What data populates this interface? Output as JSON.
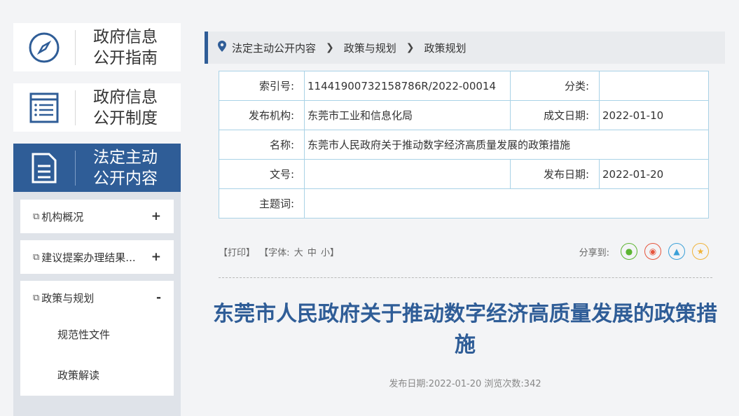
{
  "sidebar": {
    "cards": [
      {
        "label": "政府信息\n公开指南",
        "icon": "compass-icon"
      },
      {
        "label": "政府信息\n公开制度",
        "icon": "document-list-icon"
      },
      {
        "label": "法定主动\n公开内容",
        "icon": "document-icon"
      }
    ],
    "items": [
      {
        "label": "机构概况",
        "toggle": "+"
      },
      {
        "label": "建议提案办理结果...",
        "toggle": "+"
      },
      {
        "label": "政策与规划",
        "toggle": "-"
      }
    ],
    "children": [
      "规范性文件",
      "政策解读"
    ]
  },
  "breadcrumb": [
    "法定主动公开内容",
    "政策与规划",
    "政策规划"
  ],
  "info": {
    "index_label": "索引号:",
    "index_value": "11441900732158786R/2022-00014",
    "category_label": "分类:",
    "category_value": "",
    "publisher_label": "发布机构:",
    "publisher_value": "东莞市工业和信息化局",
    "created_label": "成文日期:",
    "created_value": "2022-01-10",
    "name_label": "名称:",
    "name_value": "东莞市人民政府关于推动数字经济高质量发展的政策措施",
    "docno_label": "文号:",
    "docno_value": "",
    "published_label": "发布日期:",
    "published_value": "2022-01-20",
    "keywords_label": "主题词:",
    "keywords_value": ""
  },
  "tools": {
    "print": "【打印】",
    "font_label": "【字体:",
    "font_large": "大",
    "font_medium": "中",
    "font_small": "小】",
    "share_label": "分享到:"
  },
  "article": {
    "title": "东莞市人民政府关于推动数字经济高质量发展的政策措施",
    "meta": "发布日期:2022-01-20 浏览次数:342"
  },
  "colors": {
    "primary": "#2f5d97",
    "wechat": "#5cb531",
    "weibo": "#e6543c",
    "qq": "#3aa0d8",
    "qzone": "#f0b33a"
  }
}
